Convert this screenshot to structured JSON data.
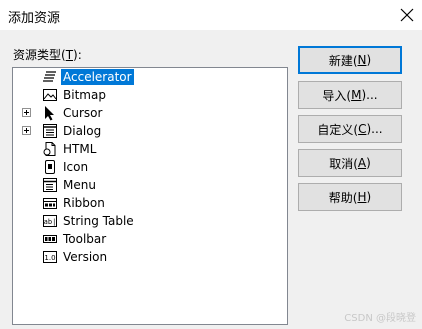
{
  "dialog": {
    "title": "添加资源",
    "list_label": "资源类型(",
    "list_label_mnemonic": "T",
    "list_label_suffix": "):",
    "watermark": "CSDN @段晓登"
  },
  "tree": [
    {
      "label": "Accelerator",
      "icon": "accelerator-icon",
      "expandable": false,
      "selected": true
    },
    {
      "label": "Bitmap",
      "icon": "bitmap-icon",
      "expandable": false,
      "selected": false
    },
    {
      "label": "Cursor",
      "icon": "cursor-icon",
      "expandable": true,
      "selected": false
    },
    {
      "label": "Dialog",
      "icon": "dialog-icon",
      "expandable": true,
      "selected": false
    },
    {
      "label": "HTML",
      "icon": "html-icon",
      "expandable": false,
      "selected": false
    },
    {
      "label": "Icon",
      "icon": "icon-resource-icon",
      "expandable": false,
      "selected": false
    },
    {
      "label": "Menu",
      "icon": "menu-icon",
      "expandable": false,
      "selected": false
    },
    {
      "label": "Ribbon",
      "icon": "ribbon-icon",
      "expandable": false,
      "selected": false
    },
    {
      "label": "String Table",
      "icon": "string-table-icon",
      "expandable": false,
      "selected": false
    },
    {
      "label": "Toolbar",
      "icon": "toolbar-icon",
      "expandable": false,
      "selected": false
    },
    {
      "label": "Version",
      "icon": "version-icon",
      "expandable": false,
      "selected": false
    }
  ],
  "buttons": {
    "new": {
      "text": "新建(",
      "mnemonic": "N",
      "suffix": ")"
    },
    "import": {
      "text": "导入(",
      "mnemonic": "M",
      "suffix": ")..."
    },
    "custom": {
      "text": "自定义(",
      "mnemonic": "C",
      "suffix": ")..."
    },
    "cancel": {
      "text": "取消(",
      "mnemonic": "A",
      "suffix": ")"
    },
    "help": {
      "text": "帮助(",
      "mnemonic": "H",
      "suffix": ")"
    }
  },
  "colors": {
    "selection": "#0078d7",
    "default_button_border": "#0078d7",
    "dialog_background": "#f0f0f0"
  }
}
